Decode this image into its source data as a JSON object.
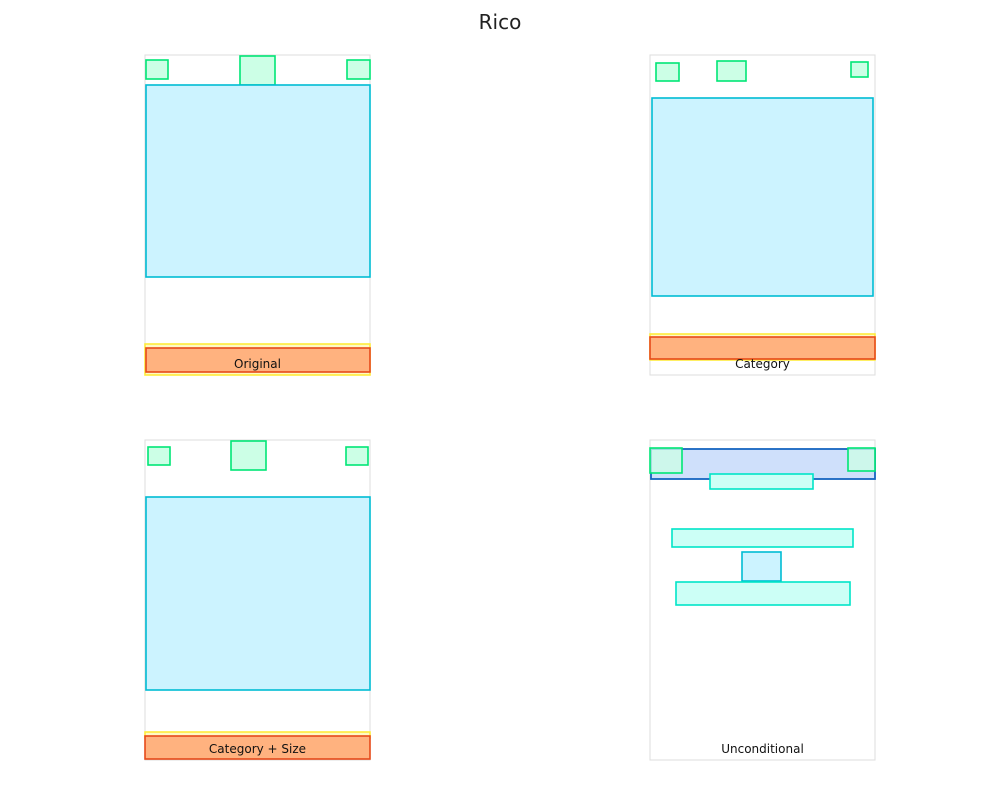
{
  "title": "Rico",
  "colors": {
    "button": "#00e676",
    "image": "#00bcd4",
    "toolbar": "#1565c0",
    "text": "#00e5c8",
    "input": "#ffeb3b",
    "bottom_bar": "#e64a19",
    "bottom_bar_fill": "#ffb27f"
  },
  "panels": [
    {
      "label": "Original",
      "elements": [
        {
          "kind": "button"
        },
        {
          "kind": "button"
        },
        {
          "kind": "button"
        },
        {
          "kind": "image"
        },
        {
          "kind": "input"
        },
        {
          "kind": "bottom_bar"
        }
      ]
    },
    {
      "label": "Category",
      "elements": [
        {
          "kind": "button"
        },
        {
          "kind": "button"
        },
        {
          "kind": "button"
        },
        {
          "kind": "image"
        },
        {
          "kind": "input"
        },
        {
          "kind": "bottom_bar"
        }
      ]
    },
    {
      "label": "Category + Size",
      "elements": [
        {
          "kind": "button"
        },
        {
          "kind": "button"
        },
        {
          "kind": "button"
        },
        {
          "kind": "image"
        },
        {
          "kind": "input"
        },
        {
          "kind": "bottom_bar"
        }
      ]
    },
    {
      "label": "Unconditional",
      "elements": [
        {
          "kind": "toolbar"
        },
        {
          "kind": "button"
        },
        {
          "kind": "button"
        },
        {
          "kind": "text"
        },
        {
          "kind": "text"
        },
        {
          "kind": "image"
        },
        {
          "kind": "text"
        }
      ]
    }
  ]
}
